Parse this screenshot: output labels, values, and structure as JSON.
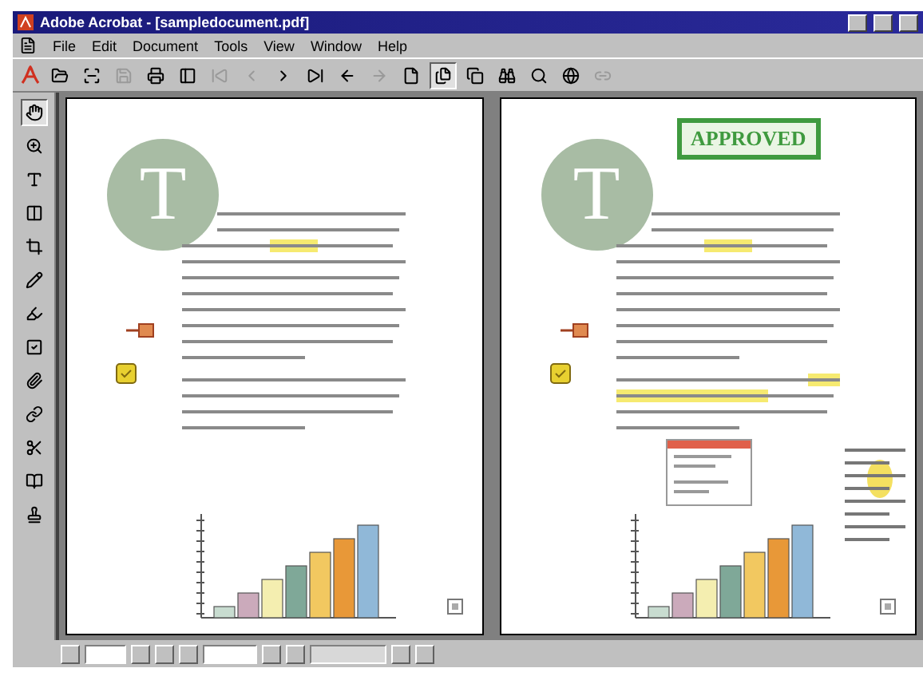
{
  "window": {
    "title": "Adobe Acrobat - [sampledocument.pdf]"
  },
  "menu": [
    "File",
    "Edit",
    "Document",
    "Tools",
    "View",
    "Window",
    "Help"
  ],
  "toolbar": [
    {
      "kind": "logo",
      "disabled": false
    },
    {
      "kind": "open",
      "disabled": false
    },
    {
      "kind": "scan",
      "disabled": false
    },
    {
      "kind": "save",
      "disabled": true
    },
    {
      "kind": "print",
      "disabled": false
    },
    {
      "kind": "panel",
      "disabled": false
    },
    {
      "kind": "first",
      "disabled": true
    },
    {
      "kind": "prev",
      "disabled": true
    },
    {
      "kind": "next",
      "disabled": false
    },
    {
      "kind": "last",
      "disabled": false
    },
    {
      "kind": "back",
      "disabled": false
    },
    {
      "kind": "forward",
      "disabled": true
    },
    {
      "kind": "single",
      "disabled": false,
      "selected": false
    },
    {
      "kind": "continuous",
      "disabled": false,
      "selected": true
    },
    {
      "kind": "facing",
      "disabled": false,
      "selected": false
    },
    {
      "kind": "find",
      "disabled": false
    },
    {
      "kind": "search",
      "disabled": false
    },
    {
      "kind": "web",
      "disabled": false
    },
    {
      "kind": "weblink",
      "disabled": true
    }
  ],
  "tools": [
    {
      "kind": "hand",
      "selected": true
    },
    {
      "kind": "zoom",
      "selected": false
    },
    {
      "kind": "text",
      "selected": false
    },
    {
      "kind": "column",
      "selected": false
    },
    {
      "kind": "crop",
      "selected": false
    },
    {
      "kind": "pencil",
      "selected": false
    },
    {
      "kind": "highlight",
      "selected": false
    },
    {
      "kind": "form",
      "selected": false
    },
    {
      "kind": "attach",
      "selected": false
    },
    {
      "kind": "link",
      "selected": false
    },
    {
      "kind": "touchup",
      "selected": false
    },
    {
      "kind": "article",
      "selected": false
    },
    {
      "kind": "stamp",
      "selected": false
    }
  ],
  "pages": [
    {
      "initial": "T"
    },
    {
      "initial": "T",
      "stamp": "APPROVED",
      "note_popup": true,
      "side_comment": true
    }
  ]
}
